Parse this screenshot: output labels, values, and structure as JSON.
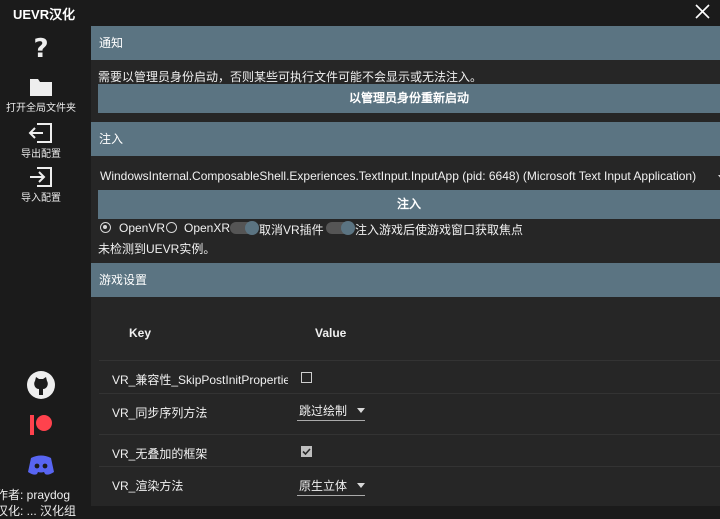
{
  "window": {
    "title": "UEVR汉化"
  },
  "sidebar": {
    "items": [
      {
        "label": "",
        "icon": "help-icon"
      },
      {
        "label": "打开全局文件夹",
        "icon": "folder-icon"
      },
      {
        "label": "导出配置",
        "icon": "export-icon"
      },
      {
        "label": "导入配置",
        "icon": "import-icon"
      }
    ],
    "social": [
      "github-icon",
      "patreon-icon",
      "discord-icon"
    ],
    "author": "作者: praydog",
    "author_line2": "汉化: ... 汉化组"
  },
  "notice": {
    "header": "通知",
    "message": "需要以管理员身份启动，否则某些可执行文件可能不会显示或无法注入。",
    "restart_button": "以管理员身份重新启动"
  },
  "inject": {
    "header": "注入",
    "process": "WindowsInternal.ComposableShell.Experiences.TextInput.InputApp (pid: 6648) (Microsoft Text Input Application)",
    "inject_button": "注入",
    "runtime_options": [
      "OpenVR",
      "OpenXR"
    ],
    "selected_runtime": "OpenVR",
    "toggle1_label": "取消VR插件",
    "toggle2_label": "注入游戏后使游戏窗口获取焦点",
    "status": "未检测到UEVR实例。"
  },
  "game_settings": {
    "header": "游戏设置",
    "columns": [
      "Key",
      "Value"
    ],
    "rows": [
      {
        "key": "VR_兼容性_SkipPostInitProperties",
        "type": "checkbox",
        "checked": false
      },
      {
        "key": "VR_同步序列方法",
        "type": "dropdown",
        "value": "跳过绘制"
      },
      {
        "key": "VR_无叠加的框架",
        "type": "checkbox",
        "checked": true
      },
      {
        "key": "VR_渲染方法",
        "type": "dropdown",
        "value": "原生立体"
      }
    ]
  },
  "colors": {
    "accent": "#5b7482",
    "background": "#1b1b1b",
    "panel": "#262626"
  }
}
